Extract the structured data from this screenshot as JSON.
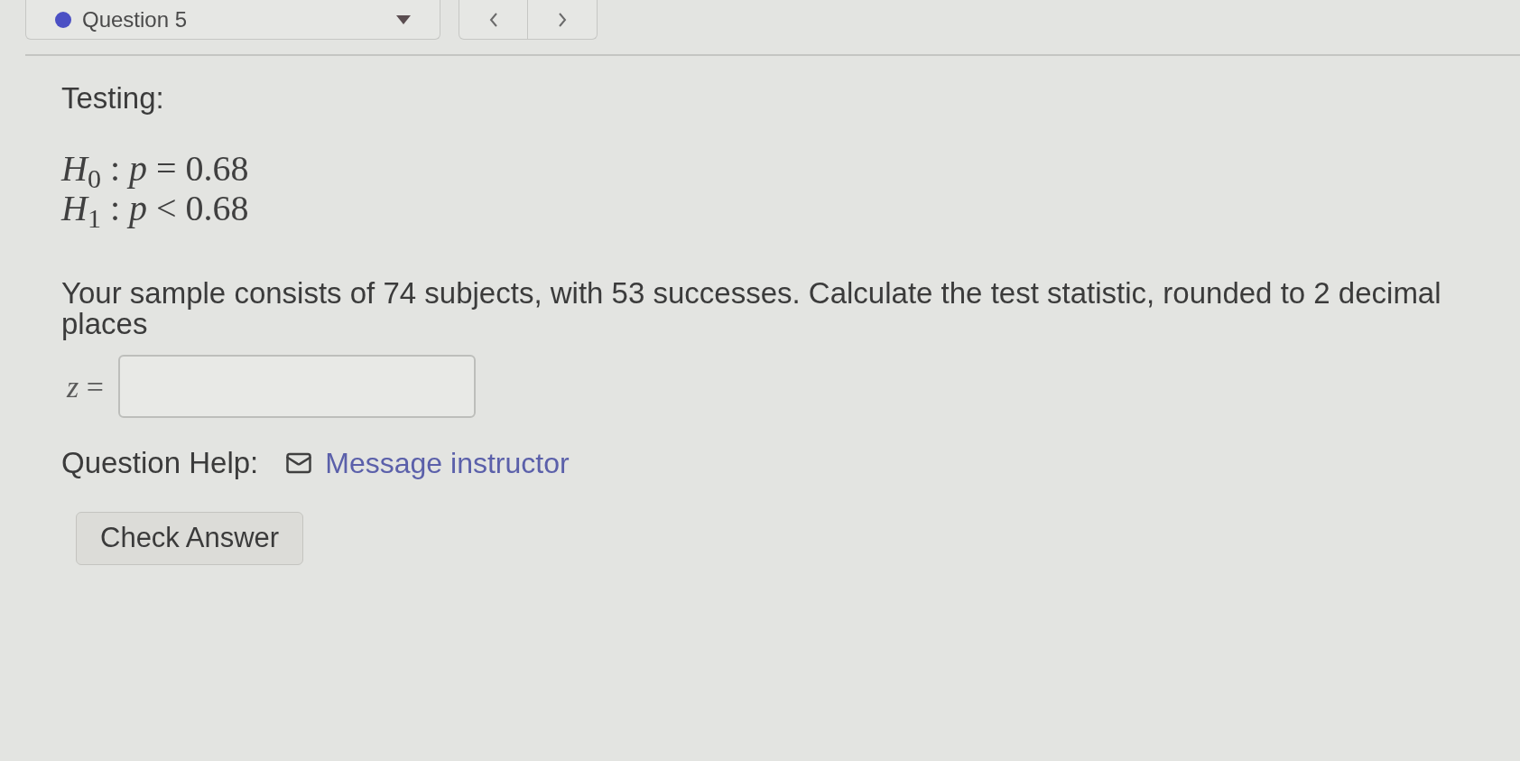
{
  "question_selector": {
    "label": "Question 5"
  },
  "testing_label": "Testing:",
  "hypotheses": [
    "*H*$_{0}$ : *p* = 0.68",
    "*H*$_{1}$ : *p* < 0.68"
  ],
  "question_text": "Your sample consists of 74 subjects, with 53 successes. Calculate the test statistic, rounded to 2 decimal places",
  "answer": {
    "label": "*z* ="
  },
  "help": {
    "label": "Question Help:",
    "link": "Message instructor"
  },
  "submit_button": "Check Answer"
}
